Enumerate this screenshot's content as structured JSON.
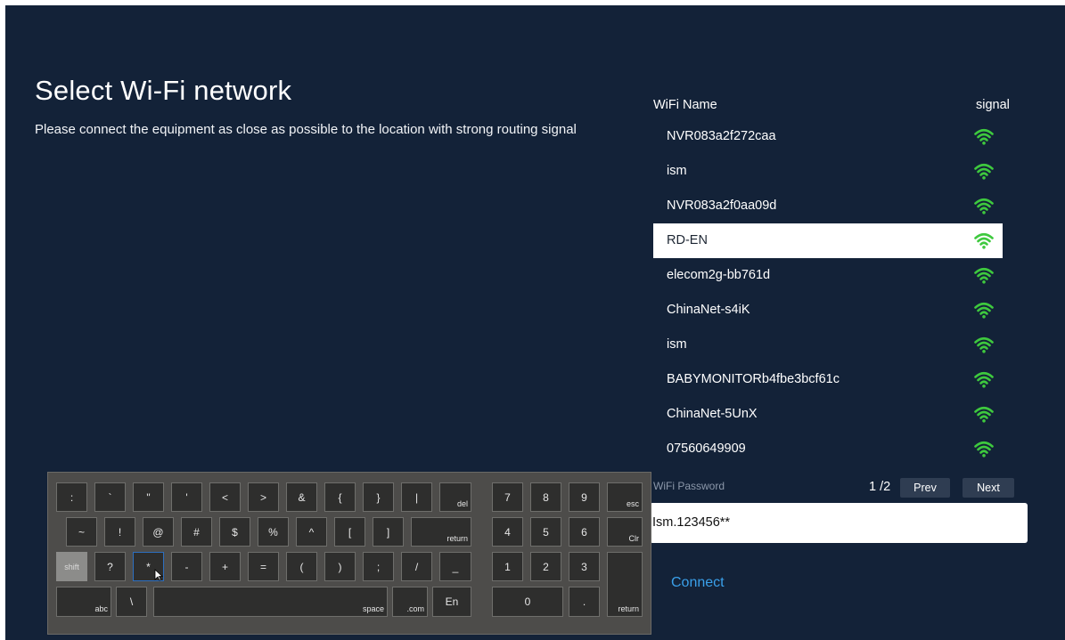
{
  "header": {
    "title": "Select Wi-Fi network",
    "subtitle": "Please connect the equipment as close as possible to the location with strong routing signal"
  },
  "wifi_list": {
    "column_name": "WiFi Name",
    "column_signal": "signal",
    "signal_icon": "wifi-signal-icon",
    "signal_color": "#3ec93e",
    "selected_index": 3,
    "networks": [
      {
        "name": "NVR083a2f272caa"
      },
      {
        "name": "ism"
      },
      {
        "name": "NVR083a2f0aa09d"
      },
      {
        "name": "RD-EN"
      },
      {
        "name": "elecom2g-bb761d"
      },
      {
        "name": "ChinaNet-s4iK"
      },
      {
        "name": "ism"
      },
      {
        "name": "BABYMONITORb4fbe3bcf61c"
      },
      {
        "name": "ChinaNet-5UnX"
      },
      {
        "name": "07560649909"
      }
    ]
  },
  "pagination": {
    "indicator": "1 /2",
    "prev_label": "Prev",
    "next_label": "Next"
  },
  "password": {
    "label": "WiFi Password",
    "value": "Ism.123456**"
  },
  "connect_label": "Connect",
  "keyboard": {
    "row1": [
      ":",
      "`",
      "\"",
      "'",
      "<",
      ">",
      "&",
      "{",
      "}",
      "|",
      "del"
    ],
    "row2": [
      "~",
      "!",
      "@",
      "#",
      "$",
      "%",
      "^",
      "[",
      "]",
      "return"
    ],
    "row3": [
      "shift",
      "?",
      "*",
      "-",
      "+",
      "=",
      "(",
      ")",
      ";",
      "/",
      "_"
    ],
    "row4": [
      "abc",
      "\\",
      "space",
      ".com",
      "En"
    ],
    "numpad": {
      "row1": [
        "7",
        "8",
        "9",
        "esc"
      ],
      "row2": [
        "4",
        "5",
        "6",
        "Clr"
      ],
      "row3": [
        "1",
        "2",
        "3"
      ],
      "row4": [
        "0",
        "."
      ],
      "return_label": "return"
    }
  },
  "colors": {
    "background": "#132238",
    "accent": "#3aa0ea",
    "keyboard_bg": "#4d4c4a"
  }
}
